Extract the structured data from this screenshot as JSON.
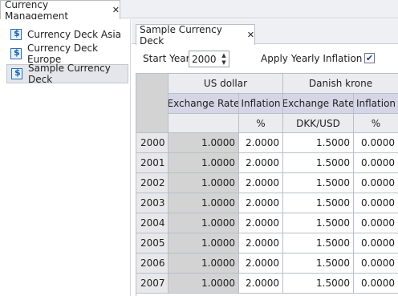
{
  "top_tab": {
    "label": "Currency Management"
  },
  "decks": [
    {
      "label": "Currency Deck Asia",
      "selected": false
    },
    {
      "label": "Currency Deck Europe",
      "selected": false
    },
    {
      "label": "Sample Currency Deck",
      "selected": true
    }
  ],
  "doc_tab": {
    "label": "Sample Currency Deck"
  },
  "options": {
    "start_year_label": "Start Year",
    "start_year_value": "2000",
    "apply_inflation_label": "Apply Yearly Inflation",
    "apply_inflation_checked": true
  },
  "grid": {
    "currencies": [
      "US dollar",
      "Danish krone"
    ],
    "sub_headers": [
      "Exchange Rate",
      "Inflation",
      "Exchange Rate",
      "Inflation"
    ],
    "units": [
      "",
      "%",
      "DKK/USD",
      "%"
    ],
    "rows": [
      {
        "year": "2000",
        "values": [
          "1.0000",
          "2.0000",
          "1.5000",
          "0.0000"
        ]
      },
      {
        "year": "2001",
        "values": [
          "1.0000",
          "2.0000",
          "1.5000",
          "0.0000"
        ]
      },
      {
        "year": "2002",
        "values": [
          "1.0000",
          "2.0000",
          "1.5000",
          "0.0000"
        ]
      },
      {
        "year": "2003",
        "values": [
          "1.0000",
          "2.0000",
          "1.5000",
          "0.0000"
        ]
      },
      {
        "year": "2004",
        "values": [
          "1.0000",
          "2.0000",
          "1.5000",
          "0.0000"
        ]
      },
      {
        "year": "2005",
        "values": [
          "1.0000",
          "2.0000",
          "1.5000",
          "0.0000"
        ]
      },
      {
        "year": "2006",
        "values": [
          "1.0000",
          "2.0000",
          "1.5000",
          "0.0000"
        ]
      },
      {
        "year": "2007",
        "values": [
          "1.0000",
          "2.0000",
          "1.5000",
          "0.0000"
        ]
      }
    ]
  }
}
